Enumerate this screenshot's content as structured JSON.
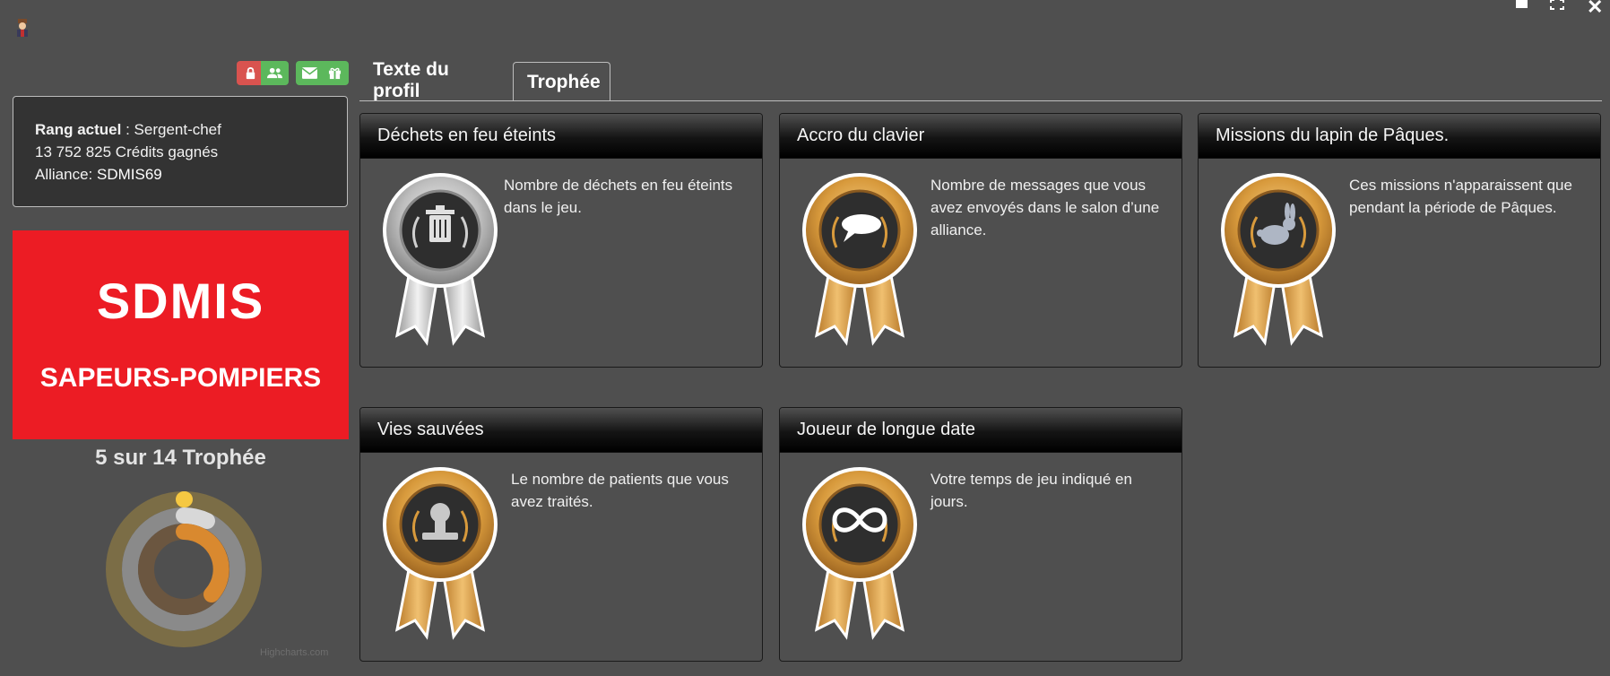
{
  "window": {
    "close_glyph": "✕"
  },
  "rank": {
    "rank_label": "Rang actuel",
    "rank_value": " : Sergent-chef",
    "credits_line": "13 752 825 Crédits gagnés",
    "alliance_label": "Alliance: ",
    "alliance_name": "SDMIS69"
  },
  "banner": {
    "title": "SDMIS",
    "subtitle": "SAPEURS-POMPIERS"
  },
  "trophies": {
    "count_text": "5 sur 14 Trophée",
    "earned": 5,
    "total": 14,
    "credit": "Highcharts.com"
  },
  "tabs": [
    {
      "label": "Texte du profil",
      "active": false
    },
    {
      "label": "Trophée",
      "active": true
    }
  ],
  "cards": [
    {
      "title": "Déchets en feu éteints",
      "description": "Nombre de déchets en feu éteints dans le jeu.",
      "medal": "silver",
      "icon": "trash-icon"
    },
    {
      "title": "Accro du clavier",
      "description": "Nombre de messages que vous avez envoyés dans le salon d’une alliance.",
      "medal": "gold",
      "icon": "speech-bubble-icon"
    },
    {
      "title": "Missions du lapin de Pâques.",
      "description": "Ces missions n'apparaissent que pendant la période de Pâques.",
      "medal": "gold",
      "icon": "rabbit-icon"
    },
    {
      "title": "Vies sauvées",
      "description": "Le nombre de patients que vous avez traités.",
      "medal": "gold",
      "icon": "patient-icon"
    },
    {
      "title": "Joueur de longue date",
      "description": "Votre temps de jeu indiqué en jours.",
      "medal": "gold",
      "icon": "infinity-icon"
    }
  ],
  "colors": {
    "banner": "#ec1c24",
    "gold": "#d89a3c",
    "silver": "#c8c8c8",
    "button_red": "#d9534f",
    "button_green": "#5cb85c"
  }
}
